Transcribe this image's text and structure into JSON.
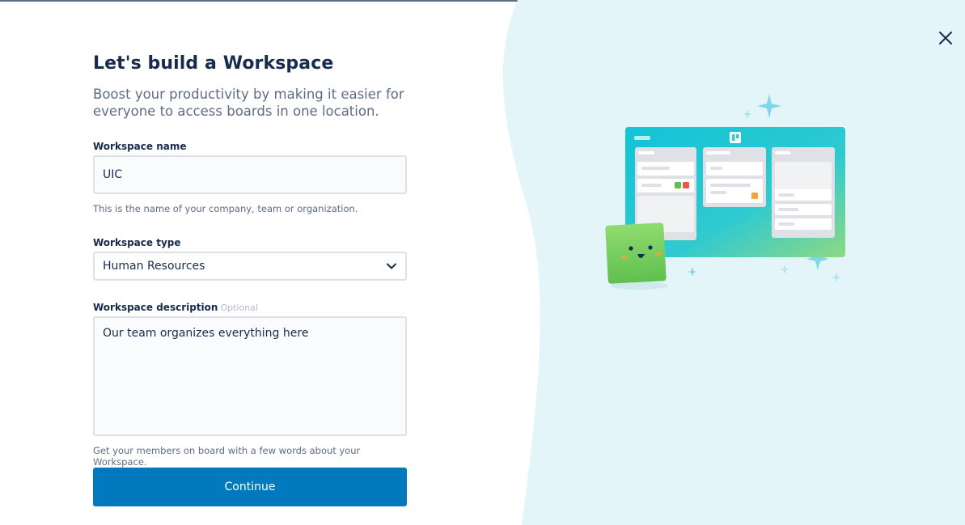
{
  "header": {
    "title": "Let's build a Workspace",
    "subtitle": "Boost your productivity by making it easier for everyone to access boards in one location."
  },
  "form": {
    "name": {
      "label": "Workspace name",
      "value": "UIC",
      "helper": "This is the name of your company, team or organization."
    },
    "type": {
      "label": "Workspace type",
      "selected": "Human Resources"
    },
    "description": {
      "label": "Workspace description",
      "optional_label": "Optional",
      "value": "Our team organizes everything here",
      "helper": "Get your members on board with a few words about your Workspace."
    },
    "continue_label": "Continue"
  },
  "icons": {
    "close": "close-icon",
    "select_arrow": "chevron-down-icon",
    "illustration": "trello-board-illustration"
  },
  "colors": {
    "primary_button": "#0079bf",
    "panel_background": "#e4f5fa",
    "title_text": "#172b4d",
    "muted_text": "#5e6c84",
    "input_border": "#dfe1e6"
  }
}
